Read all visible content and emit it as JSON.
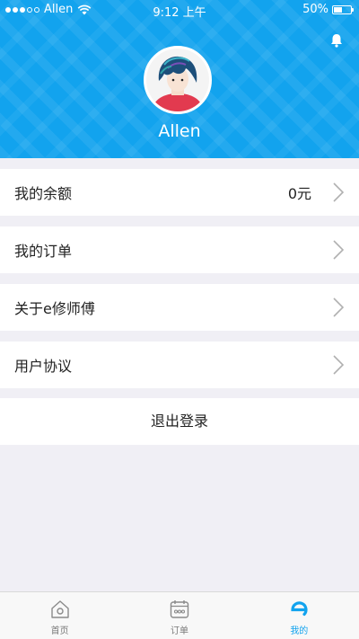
{
  "status_bar": {
    "carrier": "Allen",
    "time": "9:12 上午",
    "battery": "50%",
    "battery_level": 0.5
  },
  "header": {
    "username": "Allen",
    "bell_icon": "bell-icon",
    "avatar": "avatar-image"
  },
  "menu": {
    "items": [
      {
        "label": "我的余额",
        "value": "0元"
      },
      {
        "label": "我的订单"
      },
      {
        "label": "关于e修师傅"
      },
      {
        "label": "用户协议"
      }
    ],
    "logout_label": "退出登录"
  },
  "tabbar": {
    "tabs": [
      {
        "label": "首页",
        "icon": "home-icon"
      },
      {
        "label": "订单",
        "icon": "calendar-icon"
      },
      {
        "label": "我的",
        "icon": "e-logo-icon"
      }
    ],
    "active_index": 2
  },
  "colors": {
    "brand": "#12a3ee",
    "background": "#f0eff5",
    "inactive": "#7a7a7a"
  }
}
